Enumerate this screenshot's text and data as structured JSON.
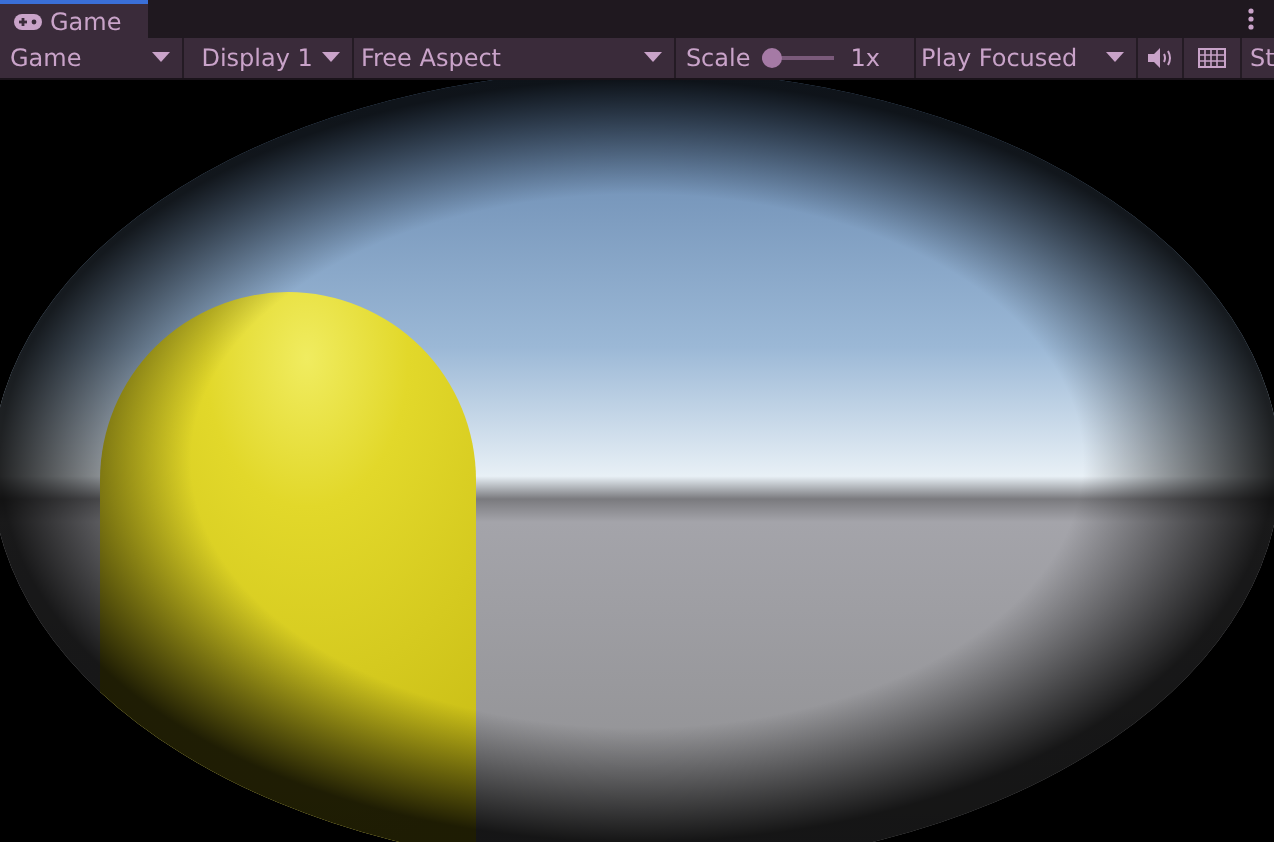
{
  "tab": {
    "label": "Game",
    "selected": true
  },
  "toolbar": {
    "view_dropdown": "Game",
    "display_dropdown": "Display 1",
    "aspect_dropdown": "Free Aspect",
    "scale": {
      "label": "Scale",
      "level": 0.0,
      "reading": "1x"
    },
    "play_mode_dropdown": "Play Focused",
    "stats_button": "St"
  }
}
